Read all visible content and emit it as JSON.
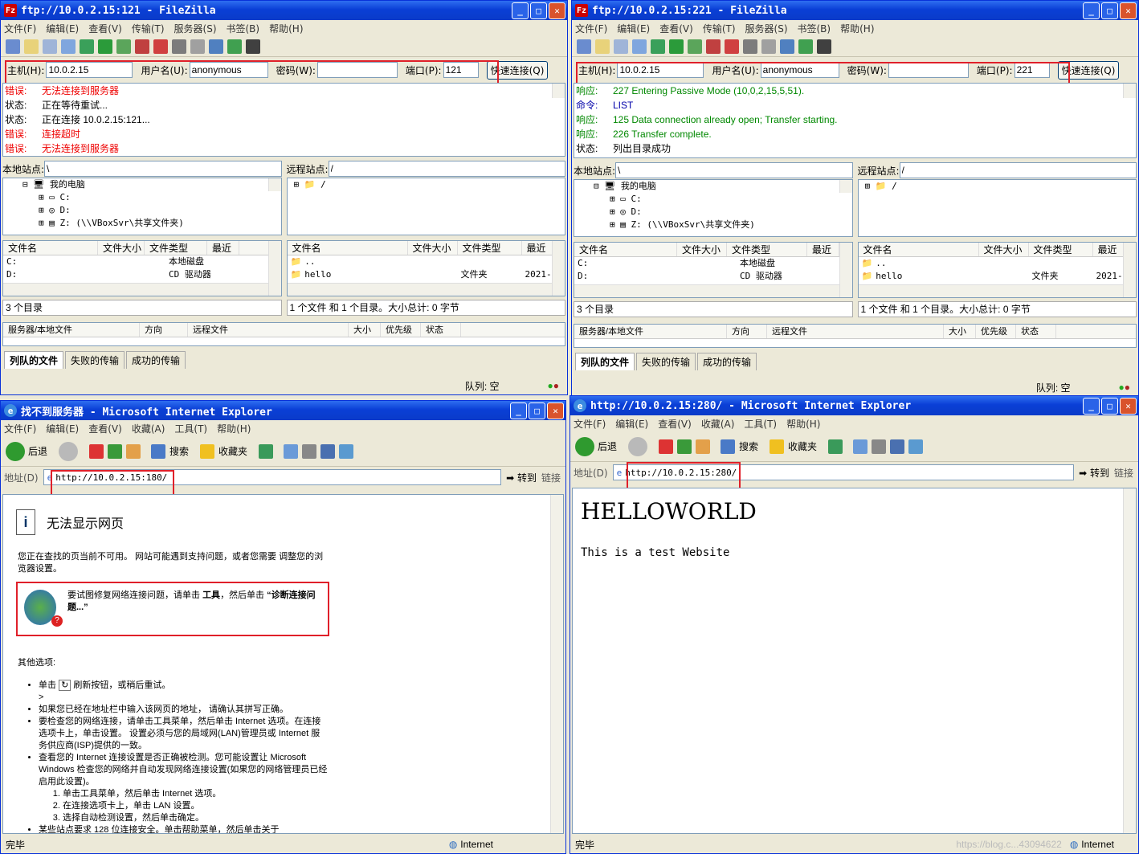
{
  "fz1": {
    "title": "ftp://10.0.2.15:121 - FileZilla",
    "menu": [
      "文件(F)",
      "编辑(E)",
      "查看(V)",
      "传输(T)",
      "服务器(S)",
      "书签(B)",
      "帮助(H)"
    ],
    "host_label": "主机(H):",
    "host": "10.0.2.15",
    "user_label": "用户名(U):",
    "user": "anonymous",
    "pass_label": "密码(W):",
    "port_label": "端口(P):",
    "port": "121",
    "connect": "快速连接(Q)",
    "log": [
      [
        "错误:",
        "无法连接到服务器",
        "err"
      ],
      [
        "状态:",
        "正在等待重试...",
        ""
      ],
      [
        "状态:",
        "正在连接 10.0.2.15:121...",
        ""
      ],
      [
        "错误:",
        "连接超时",
        "err"
      ],
      [
        "错误:",
        "无法连接到服务器",
        "err"
      ]
    ],
    "local_label": "本地站点:",
    "local_path": "\\",
    "remote_label": "远程站点:",
    "remote_path": "/",
    "tree": [
      "我的电脑",
      "C:",
      "D:",
      "Z:  (\\\\VBoxSvr\\共享文件夹)"
    ],
    "rtree": "/",
    "lcols": [
      "文件名",
      "文件大小",
      "文件类型",
      "最近"
    ],
    "lrows": [
      [
        "C:",
        "",
        "本地磁盘"
      ],
      [
        "D:",
        "",
        "CD 驱动器"
      ]
    ],
    "rcols": [
      "文件名",
      "文件大小",
      "文件类型",
      "最近"
    ],
    "rrows": [
      [
        "..",
        "",
        "",
        ""
      ],
      [
        "hello",
        "",
        "文件夹",
        "2021-"
      ]
    ],
    "lstatus": "3 个目录",
    "rstatus": "1 个文件 和 1 个目录。大小总计: 0 字节",
    "qcols": [
      "服务器/本地文件",
      "方向",
      "远程文件",
      "大小",
      "优先级",
      "状态"
    ],
    "tabs": [
      "列队的文件",
      "失败的传输",
      "成功的传输"
    ],
    "queue": "队列: 空"
  },
  "fz2": {
    "title": "ftp://10.0.2.15:221 - FileZilla",
    "menu": [
      "文件(F)",
      "编辑(E)",
      "查看(V)",
      "传输(T)",
      "服务器(S)",
      "书签(B)",
      "帮助(H)"
    ],
    "host_label": "主机(H):",
    "host": "10.0.2.15",
    "user_label": "用户名(U):",
    "user": "anonymous",
    "pass_label": "密码(W):",
    "port_label": "端口(P):",
    "port": "221",
    "connect": "快速连接(Q)",
    "log": [
      [
        "响应:",
        "227 Entering Passive Mode (10,0,2,15,5,51).",
        "grn"
      ],
      [
        "命令:",
        "LIST",
        "blu"
      ],
      [
        "响应:",
        "125 Data connection already open; Transfer starting.",
        "grn"
      ],
      [
        "响应:",
        "226 Transfer complete.",
        "grn"
      ],
      [
        "状态:",
        "列出目录成功",
        ""
      ]
    ],
    "local_label": "本地站点:",
    "local_path": "\\",
    "remote_label": "远程站点:",
    "remote_path": "/",
    "tree": [
      "我的电脑",
      "C:",
      "D:",
      "Z:  (\\\\VBoxSvr\\共享文件夹)"
    ],
    "rtree": "/",
    "lcols": [
      "文件名",
      "文件大小",
      "文件类型",
      "最近"
    ],
    "lrows": [
      [
        "C:",
        "",
        "本地磁盘"
      ],
      [
        "D:",
        "",
        "CD 驱动器"
      ]
    ],
    "rcols": [
      "文件名",
      "文件大小",
      "文件类型",
      "最近"
    ],
    "rrows": [
      [
        "..",
        "",
        "",
        ""
      ],
      [
        "hello",
        "",
        "文件夹",
        "2021-"
      ]
    ],
    "lstatus": "3 个目录",
    "rstatus": "1 个文件 和 1 个目录。大小总计: 0 字节",
    "qcols": [
      "服务器/本地文件",
      "方向",
      "远程文件",
      "大小",
      "优先级",
      "状态"
    ],
    "tabs": [
      "列队的文件",
      "失败的传输",
      "成功的传输"
    ],
    "queue": "队列: 空"
  },
  "ie1": {
    "title": "找不到服务器 - Microsoft Internet Explorer",
    "menu": [
      "文件(F)",
      "编辑(E)",
      "查看(V)",
      "收藏(A)",
      "工具(T)",
      "帮助(H)"
    ],
    "back": "后退",
    "search": "搜索",
    "fav": "收藏夹",
    "addr_label": "地址(D)",
    "url": "http://10.0.2.15:180/",
    "go": "转到",
    "links": "链接",
    "heading": "无法显示网页",
    "p1": "您正在查找的页当前不可用。 网站可能遇到支持问题，或者您需要 调整您的浏览器设置。",
    "fix_a": "要试图修复网络连接问题，请单击 ",
    "fix_b": "工具",
    "fix_c": "，然后单击 ",
    "fix_d": "“诊断连接问题...”",
    "other": "其他选项:",
    "b1a": "单击 ",
    "b1b": " 刷新按钮，或稍后重试。",
    "b1c": ">",
    "b2": "如果您已经在地址栏中输入该网页的地址， 请确认其拼写正确。",
    "b3": "要检查您的网络连接，请单击工具菜单，然后单击 Internet 选项。在连接选项卡上，单击设置。 设置必须与您的局域网(LAN)管理员或 Internet 服务供应商(ISP)提供的一致。",
    "b4": "查看您的 Internet 连接设置是否正确被检测。您可能设置让 Microsoft Windows 检查您的网络并自动发现网络连接设置(如果您的网络管理员已经启用此设置)。",
    "s1": "单击工具菜单，然后单击 Internet 选项。",
    "s2": "在连接选项卡上，单击 LAN 设置。",
    "s3": "选择自动检测设置，然后单击确定。",
    "b5": "某些站点要求 128 位连接安全。单击帮助菜单，然后单击关于",
    "status": "完毕",
    "zone": "Internet"
  },
  "ie2": {
    "title": "http://10.0.2.15:280/ - Microsoft Internet Explorer",
    "menu": [
      "文件(F)",
      "编辑(E)",
      "查看(V)",
      "收藏(A)",
      "工具(T)",
      "帮助(H)"
    ],
    "back": "后退",
    "search": "搜索",
    "fav": "收藏夹",
    "addr_label": "地址(D)",
    "url": "http://10.0.2.15:280/",
    "go": "转到",
    "links": "链接",
    "heading": "HELLOWORLD",
    "text": "This is a test Website",
    "status": "完毕",
    "zone": "Internet",
    "watermark": "https://blog.c...43094622"
  },
  "colors": {
    "titlebar": "#0a3fd6",
    "highlight": "#e0202a"
  }
}
